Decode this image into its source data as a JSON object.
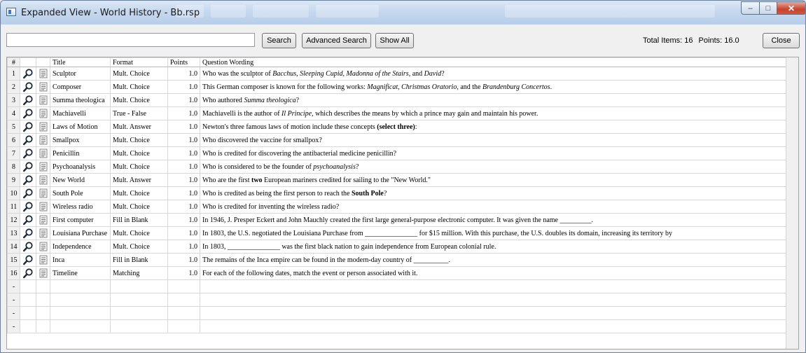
{
  "window": {
    "title": "Expanded View - World History - Bb.rsp"
  },
  "toolbar": {
    "search_value": "",
    "search_label": "Search",
    "advanced_label": "Advanced Search",
    "show_all_label": "Show All",
    "total_items": "Total Items: 16",
    "points": "Points: 16.0",
    "close_label": "Close"
  },
  "grid": {
    "columns": [
      "#",
      "",
      "",
      "Title",
      "Format",
      "Points",
      "Question Wording"
    ],
    "rows": [
      {
        "n": "1",
        "title": "Sculptor",
        "format": "Mult. Choice",
        "points": "1.0",
        "wording": [
          [
            "Who was the sculptor of ",
            ""
          ],
          [
            "Bacchus, Sleeping Cupid, Madonna of the Stairs,",
            "i"
          ],
          [
            " and ",
            ""
          ],
          [
            "David",
            "i"
          ],
          [
            "?",
            ""
          ]
        ]
      },
      {
        "n": "2",
        "title": "Composer",
        "format": "Mult. Choice",
        "points": "1.0",
        "wording": [
          [
            "This German composer is known for the following works: ",
            ""
          ],
          [
            "Magnificat, Christmas Oratorio,",
            "i"
          ],
          [
            " and the ",
            ""
          ],
          [
            "Brandenburg Concertos",
            "i"
          ],
          [
            ".",
            ""
          ]
        ]
      },
      {
        "n": "3",
        "title": "Summa theologica",
        "format": "Mult. Choice",
        "points": "1.0",
        "wording": [
          [
            "Who authored ",
            ""
          ],
          [
            "Summa theologica",
            "i"
          ],
          [
            "?",
            ""
          ]
        ]
      },
      {
        "n": "4",
        "title": "Machiavelli",
        "format": "True - False",
        "points": "1.0",
        "wording": [
          [
            "Machiavelli is the author of ",
            ""
          ],
          [
            "Il Principe",
            "i"
          ],
          [
            ", which describes the means by which a prince may gain and maintain his power.",
            ""
          ]
        ]
      },
      {
        "n": "5",
        "title": "Laws of Motion",
        "format": "Mult. Answer",
        "points": "1.0",
        "wording": [
          [
            "Newton's three famous laws of motion include these concepts ",
            ""
          ],
          [
            "(select three)",
            "b"
          ],
          [
            ":",
            ""
          ]
        ]
      },
      {
        "n": "6",
        "title": "Smallpox",
        "format": "Mult. Choice",
        "points": "1.0",
        "wording": [
          [
            "Who discovered the vaccine for smallpox?",
            ""
          ]
        ]
      },
      {
        "n": "7",
        "title": "Penicillin",
        "format": "Mult. Choice",
        "points": "1.0",
        "wording": [
          [
            "Who is credited for discovering the antibacterial medicine penicillin?",
            ""
          ]
        ]
      },
      {
        "n": "8",
        "title": "Psychoanalysis",
        "format": "Mult. Choice",
        "points": "1.0",
        "wording": [
          [
            "Who is considered to be the founder of ",
            ""
          ],
          [
            "psychoanalysis",
            "i"
          ],
          [
            "?",
            ""
          ]
        ]
      },
      {
        "n": "9",
        "title": "New World",
        "format": "Mult. Answer",
        "points": "1.0",
        "wording": [
          [
            "Who are the first ",
            ""
          ],
          [
            "two",
            "b"
          ],
          [
            " European mariners credited for sailing to the \"New World.\"",
            ""
          ]
        ]
      },
      {
        "n": "10",
        "title": "South Pole",
        "format": "Mult. Choice",
        "points": "1.0",
        "wording": [
          [
            "Who is credited as being the first person to reach the ",
            ""
          ],
          [
            "South Pole",
            "b"
          ],
          [
            "?",
            ""
          ]
        ]
      },
      {
        "n": "11",
        "title": "Wireless radio",
        "format": "Mult. Choice",
        "points": "1.0",
        "wording": [
          [
            "Who is credited for inventing the wireless radio?",
            ""
          ]
        ]
      },
      {
        "n": "12",
        "title": "First computer",
        "format": "Fill in Blank",
        "points": "1.0",
        "wording": [
          [
            "In 1946, J. Presper Eckert and John Mauchly created the first large general-purpose electronic computer. It was given the name _________.",
            ""
          ]
        ]
      },
      {
        "n": "13",
        "title": "Louisiana Purchase",
        "format": "Mult. Choice",
        "points": "1.0",
        "wording": [
          [
            "In 1803, the U.S. negotiated the Louisiana Purchase from _______________ for $15 million. With this purchase, the U.S. doubles its domain, increasing its territory by",
            ""
          ]
        ]
      },
      {
        "n": "14",
        "title": "Independence",
        "format": "Mult. Choice",
        "points": "1.0",
        "wording": [
          [
            "In 1803, _______________ was the first black nation to gain independence from European colonial rule.",
            ""
          ]
        ]
      },
      {
        "n": "15",
        "title": "Inca",
        "format": "Fill in Blank",
        "points": "1.0",
        "wording": [
          [
            "The remains of the Inca empire can be found in the modern-day country of __________.",
            ""
          ]
        ]
      },
      {
        "n": "16",
        "title": "Timeline",
        "format": "Matching",
        "points": "1.0",
        "wording": [
          [
            "For each of the following dates, match the event or person associated with it.",
            ""
          ]
        ]
      }
    ],
    "empty_marker": "-",
    "empty_rows": 4
  },
  "icons": {
    "preview": "magnifier-icon",
    "edit": "document-icon"
  }
}
